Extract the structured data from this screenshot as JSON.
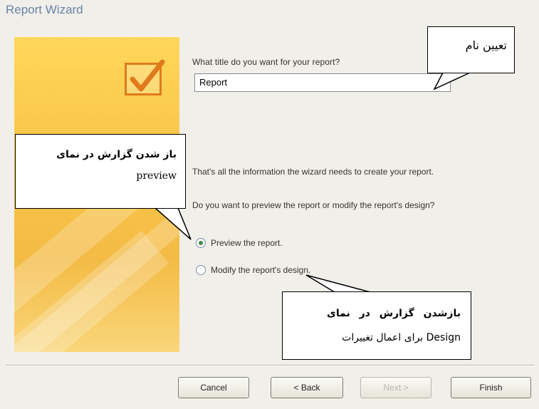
{
  "window": {
    "title": "Report Wizard"
  },
  "title_section": {
    "question": "What title do you want for your report?",
    "input_value": "Report"
  },
  "info": {
    "line1": "That's all the information the wizard needs to create your report.",
    "line2": "Do you want to preview the report or modify the report's design?"
  },
  "options": [
    {
      "label": "Preview the report.",
      "selected": true
    },
    {
      "label": "Modify the report's design.",
      "selected": false
    }
  ],
  "buttons": {
    "cancel": "Cancel",
    "back": "< Back",
    "next": "Next >",
    "finish": "Finish"
  },
  "callouts": {
    "title_name": "تعیین نام",
    "preview_line1": "باز شدن گزارش در نمای",
    "preview_line2": "preview",
    "design_line1": "بازشدن گزارش در نمای",
    "design_line2": "Design برای اعمال تغییرات"
  }
}
